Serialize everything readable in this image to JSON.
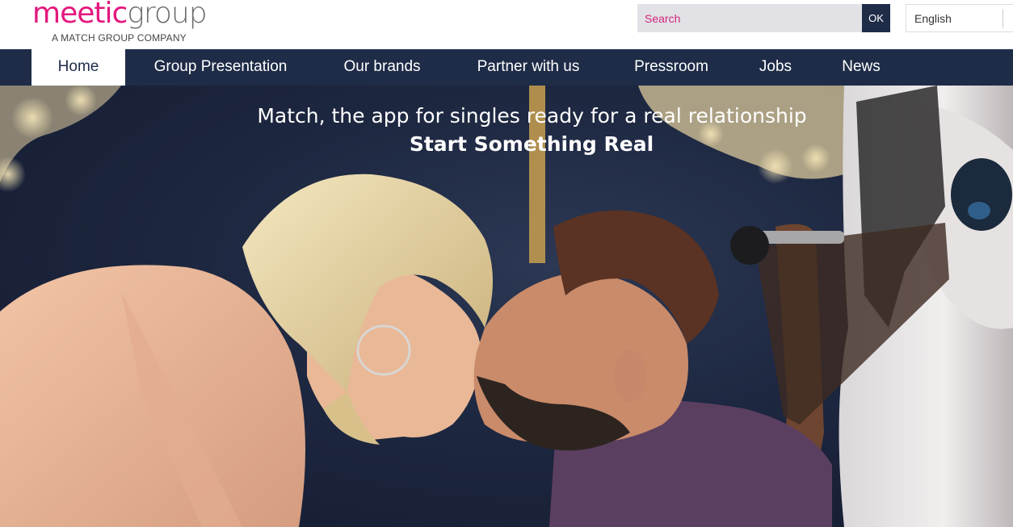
{
  "brand": {
    "logo_primary": "meetic",
    "logo_secondary": "group",
    "tagline": "A MATCH GROUP COMPANY",
    "primary_color": "#e3187d",
    "navy_color": "#1e2c47"
  },
  "header": {
    "search": {
      "placeholder": "Search",
      "submit_label": "OK"
    },
    "language": {
      "selected": "English"
    }
  },
  "nav": {
    "items": [
      {
        "label": "Home",
        "active": true
      },
      {
        "label": "Group Presentation",
        "active": false
      },
      {
        "label": "Our brands",
        "active": false
      },
      {
        "label": "Partner with us",
        "active": false
      },
      {
        "label": "Pressroom",
        "active": false
      },
      {
        "label": "Jobs",
        "active": false
      },
      {
        "label": "News",
        "active": false
      }
    ]
  },
  "hero": {
    "subtitle": "Match, the app for singles ready for a real relationship",
    "title": "Start Something Real",
    "image_alt": "couple-kissing-on-carousel-photo"
  }
}
